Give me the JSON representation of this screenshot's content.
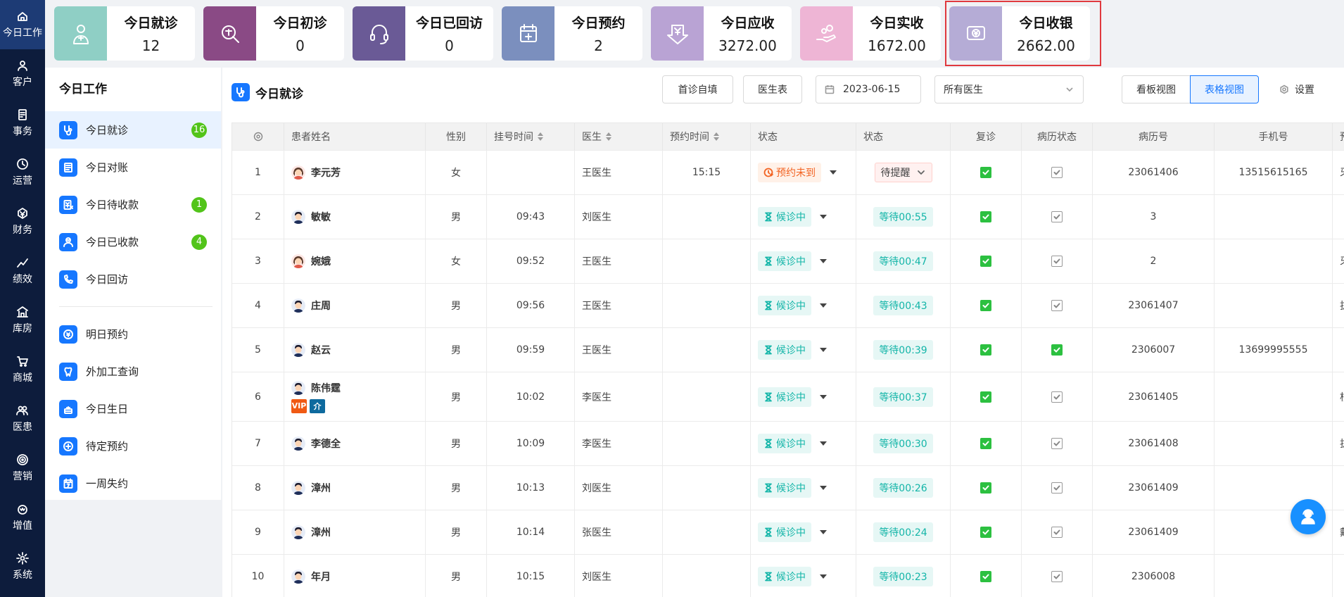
{
  "rail": [
    {
      "label": "今日工作",
      "icon": "home-icon",
      "active": true
    },
    {
      "label": "客户",
      "icon": "user-icon"
    },
    {
      "label": "事务",
      "icon": "task-icon"
    },
    {
      "label": "运营",
      "icon": "clock-icon"
    },
    {
      "label": "财务",
      "icon": "yen-icon"
    },
    {
      "label": "绩效",
      "icon": "chart-icon"
    },
    {
      "label": "库房",
      "icon": "warehouse-icon"
    },
    {
      "label": "商城",
      "icon": "cart-icon"
    },
    {
      "label": "医患",
      "icon": "people-icon"
    },
    {
      "label": "营销",
      "icon": "target-icon"
    },
    {
      "label": "增值",
      "icon": "crown-icon"
    },
    {
      "label": "系统",
      "icon": "gear-icon"
    }
  ],
  "stats": [
    {
      "title": "今日就诊",
      "value": "12",
      "color": "#8fcfc5",
      "icon": "doctor-icon"
    },
    {
      "title": "今日初诊",
      "value": "0",
      "color": "#8a4a85",
      "icon": "first-visit-icon"
    },
    {
      "title": "今日已回访",
      "value": "0",
      "color": "#6a5a96",
      "icon": "headset-icon"
    },
    {
      "title": "今日预约",
      "value": "2",
      "color": "#7b8fbe",
      "icon": "calendar-icon"
    },
    {
      "title": "今日应收",
      "value": "3272.00",
      "color": "#b9a3d4",
      "icon": "yen-down-icon"
    },
    {
      "title": "今日实收",
      "value": "1672.00",
      "color": "#eeb5d5",
      "icon": "hand-coins-icon"
    },
    {
      "title": "今日收银",
      "value": "2662.00",
      "color": "#b5acd6",
      "icon": "cashier-icon"
    }
  ],
  "sidebar": {
    "title": "今日工作",
    "items": [
      {
        "label": "今日就诊",
        "badge": "16",
        "icon": "stethoscope-icon",
        "active": true
      },
      {
        "label": "今日对账",
        "badge": "",
        "icon": "ledger-icon"
      },
      {
        "label": "今日待收款",
        "badge": "1",
        "icon": "invoice-icon"
      },
      {
        "label": "今日已收款",
        "badge": "4",
        "icon": "receipt-icon"
      },
      {
        "label": "今日回访",
        "badge": "",
        "icon": "phone-icon"
      }
    ],
    "items2": [
      {
        "label": "明日预约",
        "icon": "calendar-plus-icon"
      },
      {
        "label": "外加工查询",
        "icon": "tooth-icon"
      },
      {
        "label": "今日生日",
        "icon": "cake-icon"
      },
      {
        "label": "待定预约",
        "icon": "add-clock-icon"
      },
      {
        "label": "一周失约",
        "icon": "calendar-7-icon"
      }
    ]
  },
  "toolbar": {
    "title": "今日就诊",
    "self_fill": "首诊自填",
    "doctor_table": "医生表",
    "date": "2023-06-15",
    "doctor_select": "所有医生",
    "kanban": "看板视图",
    "table_view": "表格视图",
    "settings": "设置"
  },
  "table": {
    "headers": [
      "",
      "患者姓名",
      "性别",
      "挂号时间",
      "医生",
      "预约时间",
      "状态",
      "状态",
      "复诊",
      "病历状态",
      "病历号",
      "手机号",
      "预"
    ],
    "rows": [
      {
        "no": "1",
        "name": "李元芳",
        "gender": "女",
        "reg": "",
        "doctor": "王医生",
        "appt": "15:15",
        "status": "预约未到",
        "wait": "待提醒",
        "revisit": true,
        "record": false,
        "recno": "23061406",
        "phone": "13515615165",
        "extra": "牙",
        "tags": []
      },
      {
        "no": "2",
        "name": "敏敏",
        "gender": "男",
        "reg": "09:43",
        "doctor": "刘医生",
        "appt": "",
        "status": "候诊中",
        "wait": "等待00:55",
        "revisit": true,
        "record": false,
        "recno": "3",
        "phone": "",
        "extra": "",
        "tags": []
      },
      {
        "no": "3",
        "name": "婉娥",
        "gender": "女",
        "reg": "09:52",
        "doctor": "王医生",
        "appt": "",
        "status": "候诊中",
        "wait": "等待00:47",
        "revisit": true,
        "record": false,
        "recno": "2",
        "phone": "",
        "extra": "牙",
        "tags": []
      },
      {
        "no": "4",
        "name": "庄周",
        "gender": "男",
        "reg": "09:56",
        "doctor": "王医生",
        "appt": "",
        "status": "候诊中",
        "wait": "等待00:43",
        "revisit": true,
        "record": false,
        "recno": "23061407",
        "phone": "",
        "extra": "拔",
        "tags": []
      },
      {
        "no": "5",
        "name": "赵云",
        "gender": "男",
        "reg": "09:59",
        "doctor": "王医生",
        "appt": "",
        "status": "候诊中",
        "wait": "等待00:39",
        "revisit": true,
        "record": true,
        "recno": "2306007",
        "phone": "13699995555",
        "extra": "",
        "tags": []
      },
      {
        "no": "6",
        "name": "陈伟霆",
        "gender": "男",
        "reg": "10:02",
        "doctor": "李医生",
        "appt": "",
        "status": "候诊中",
        "wait": "等待00:37",
        "revisit": true,
        "record": false,
        "recno": "23061405",
        "phone": "",
        "extra": "根",
        "tags": [
          "VIP",
          "介"
        ]
      },
      {
        "no": "7",
        "name": "李德全",
        "gender": "男",
        "reg": "10:09",
        "doctor": "李医生",
        "appt": "",
        "status": "候诊中",
        "wait": "等待00:30",
        "revisit": true,
        "record": false,
        "recno": "23061408",
        "phone": "",
        "extra": "拔",
        "tags": []
      },
      {
        "no": "8",
        "name": "漳州",
        "gender": "男",
        "reg": "10:13",
        "doctor": "刘医生",
        "appt": "",
        "status": "候诊中",
        "wait": "等待00:26",
        "revisit": true,
        "record": false,
        "recno": "23061409",
        "phone": "",
        "extra": "",
        "tags": []
      },
      {
        "no": "9",
        "name": "漳州",
        "gender": "男",
        "reg": "10:14",
        "doctor": "张医生",
        "appt": "",
        "status": "候诊中",
        "wait": "等待00:24",
        "revisit": true,
        "record": false,
        "recno": "23061409",
        "phone": "",
        "extra": "戴",
        "tags": []
      },
      {
        "no": "10",
        "name": "年月",
        "gender": "男",
        "reg": "10:15",
        "doctor": "刘医生",
        "appt": "",
        "status": "候诊中",
        "wait": "等待00:23",
        "revisit": true,
        "record": false,
        "recno": "2306008",
        "phone": "",
        "extra": "",
        "tags": []
      }
    ]
  },
  "colors": {
    "accent": "#1677ff",
    "rail": "#0d1c3c",
    "rail_active": "#1d3b75",
    "ok": "#2cc040",
    "badge": "#52c41a",
    "vip": "#f05a14",
    "intro": "#0e6a9e"
  }
}
